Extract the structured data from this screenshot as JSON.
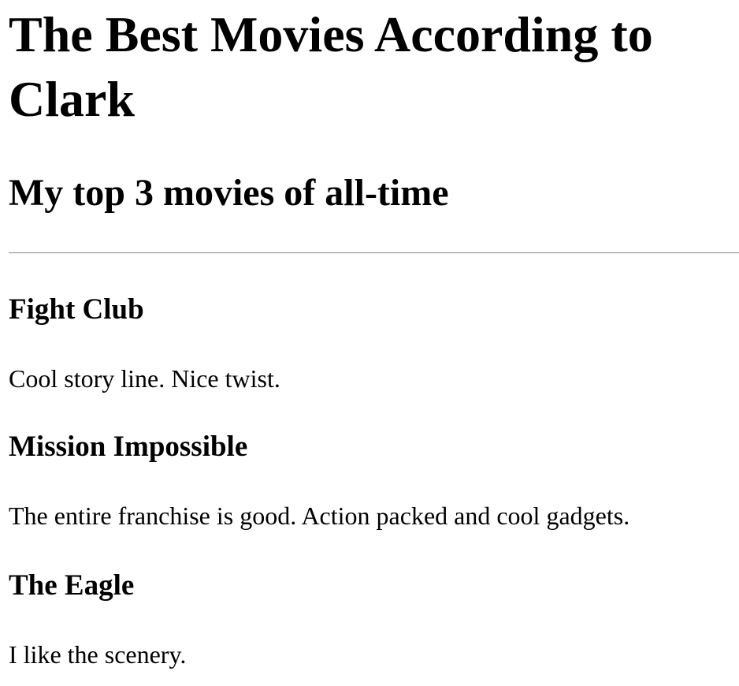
{
  "page": {
    "title": "The Best Movies According to Clark",
    "subtitle": "My top 3 movies of all-time"
  },
  "movies": [
    {
      "name": "Fight Club",
      "review": "Cool story line. Nice twist."
    },
    {
      "name": "Mission Impossible",
      "review": "The entire franchise is good. Action packed and cool gadgets."
    },
    {
      "name": "The Eagle",
      "review": "I like the scenery."
    }
  ]
}
